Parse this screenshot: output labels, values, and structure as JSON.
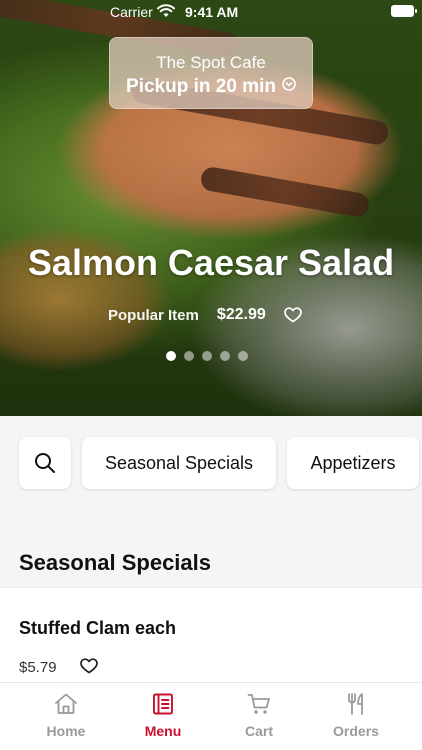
{
  "status_bar": {
    "carrier": "Carrier",
    "time": "9:41 AM"
  },
  "location": {
    "cafe_name": "The Spot Cafe",
    "pickup": "Pickup in 20 min"
  },
  "featured": {
    "title": "Salmon Caesar Salad",
    "tag": "Popular Item",
    "price": "$22.99",
    "carousel": {
      "count": 5,
      "active_index": 0
    }
  },
  "categories": {
    "search_icon": "search-icon",
    "items": [
      "Seasonal Specials",
      "Appetizers"
    ]
  },
  "section": {
    "title": "Seasonal Specials",
    "items": [
      {
        "name": "Stuffed Clam each",
        "price": "$5.79"
      }
    ]
  },
  "tabbar": {
    "items": [
      {
        "label": "Home",
        "icon": "home-icon"
      },
      {
        "label": "Menu",
        "icon": "menu-icon",
        "active": true
      },
      {
        "label": "Cart",
        "icon": "cart-icon"
      },
      {
        "label": "Orders",
        "icon": "orders-icon"
      }
    ]
  },
  "colors": {
    "accent": "#c8102e",
    "inactive": "#9a9a9a",
    "background": "#f5f5f5"
  }
}
